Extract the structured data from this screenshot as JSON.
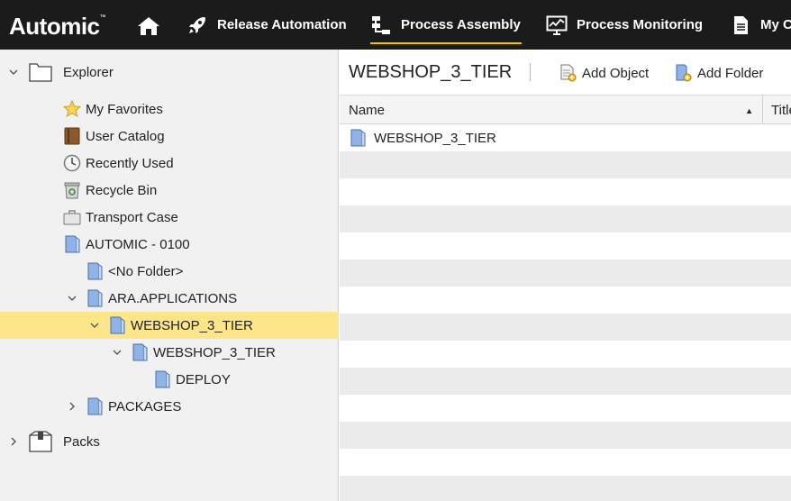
{
  "nav": {
    "logo": "Automic",
    "logo_tm": "™",
    "items": [
      {
        "label": "Release Automation",
        "icon": "rocket-icon"
      },
      {
        "label": "Process Assembly",
        "icon": "process-assembly-icon",
        "active": true
      },
      {
        "label": "Process Monitoring",
        "icon": "monitor-icon"
      },
      {
        "label": "My C",
        "icon": "document-icon"
      }
    ],
    "accent": "#f5c400"
  },
  "explorer": {
    "root": "Explorer",
    "items": [
      {
        "label": "My Favorites",
        "icon": "star-icon"
      },
      {
        "label": "User Catalog",
        "icon": "book-icon"
      },
      {
        "label": "Recently Used",
        "icon": "clock-icon"
      },
      {
        "label": "Recycle Bin",
        "icon": "recycle-bin-icon"
      },
      {
        "label": "Transport Case",
        "icon": "transport-case-icon"
      },
      {
        "label": "AUTOMIC - 0100",
        "icon": "folder-icon"
      },
      {
        "label": "<No Folder>",
        "icon": "folder-icon"
      },
      {
        "label": "ARA.APPLICATIONS",
        "icon": "folder-icon"
      },
      {
        "label": "WEBSHOP_3_TIER",
        "icon": "folder-icon",
        "selected": true
      },
      {
        "label": "WEBSHOP_3_TIER",
        "icon": "folder-icon"
      },
      {
        "label": "DEPLOY",
        "icon": "folder-icon"
      },
      {
        "label": "PACKAGES",
        "icon": "folder-icon"
      }
    ],
    "packs": "Packs",
    "selected_color": "#fde68a"
  },
  "content": {
    "title": "WEBSHOP_3_TIER",
    "add_object": "Add Object",
    "add_folder": "Add Folder",
    "columns": {
      "name": "Name",
      "title": "Title"
    },
    "rows": [
      {
        "name": "WEBSHOP_3_TIER",
        "icon": "folder-icon"
      }
    ]
  }
}
